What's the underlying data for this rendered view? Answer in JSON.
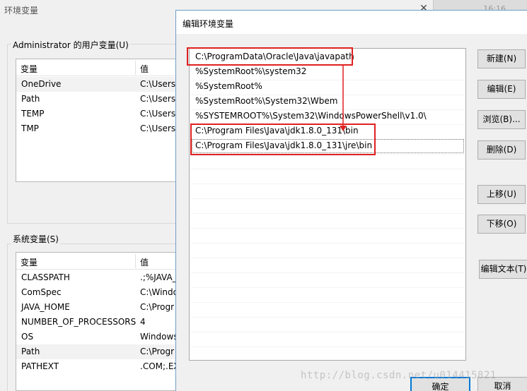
{
  "bg_window": {
    "title": "环境变量",
    "close_glyph": "✕",
    "clock": "16:16",
    "user_vars": {
      "label": "Administrator 的用户变量(U)",
      "col_var": "变量",
      "col_val": "值",
      "rows": [
        {
          "name": "OneDrive",
          "value": "C:\\Users\\"
        },
        {
          "name": "Path",
          "value": "C:\\Users\\"
        },
        {
          "name": "TEMP",
          "value": "C:\\Users\\"
        },
        {
          "name": "TMP",
          "value": "C:\\Users\\"
        }
      ]
    },
    "system_vars": {
      "label": "系统变量(S)",
      "col_var": "变量",
      "col_val": "值",
      "rows": [
        {
          "name": "CLASSPATH",
          "value": ".;%JAVA_"
        },
        {
          "name": "ComSpec",
          "value": "C:\\Windo"
        },
        {
          "name": "JAVA_HOME",
          "value": "C:\\Progr"
        },
        {
          "name": "NUMBER_OF_PROCESSORS",
          "value": "4"
        },
        {
          "name": "OS",
          "value": "Windows"
        },
        {
          "name": "Path",
          "value": "C:\\Progr"
        },
        {
          "name": "PATHEXT",
          "value": ".COM;.EX"
        }
      ]
    }
  },
  "dialog": {
    "title": "编辑环境变量",
    "paths": [
      "C:\\ProgramData\\Oracle\\Java\\javapath",
      "%SystemRoot%\\system32",
      "%SystemRoot%",
      "%SystemRoot%\\System32\\Wbem",
      "%SYSTEMROOT%\\System32\\WindowsPowerShell\\v1.0\\",
      "C:\\Program Files\\Java\\jdk1.8.0_131\\bin",
      "C:\\Program Files\\Java\\jdk1.8.0_131\\jre\\bin"
    ],
    "buttons": {
      "new": "新建(N)",
      "edit": "编辑(E)",
      "browse": "浏览(B)...",
      "delete": "删除(D)",
      "move_up": "上移(U)",
      "move_down": "下移(O)",
      "edit_text": "编辑文本(T)",
      "ok": "确定",
      "cancel": "取消"
    },
    "annotation_color": "#e02020"
  },
  "watermark": "http://blog.csdn.net/u014415821"
}
